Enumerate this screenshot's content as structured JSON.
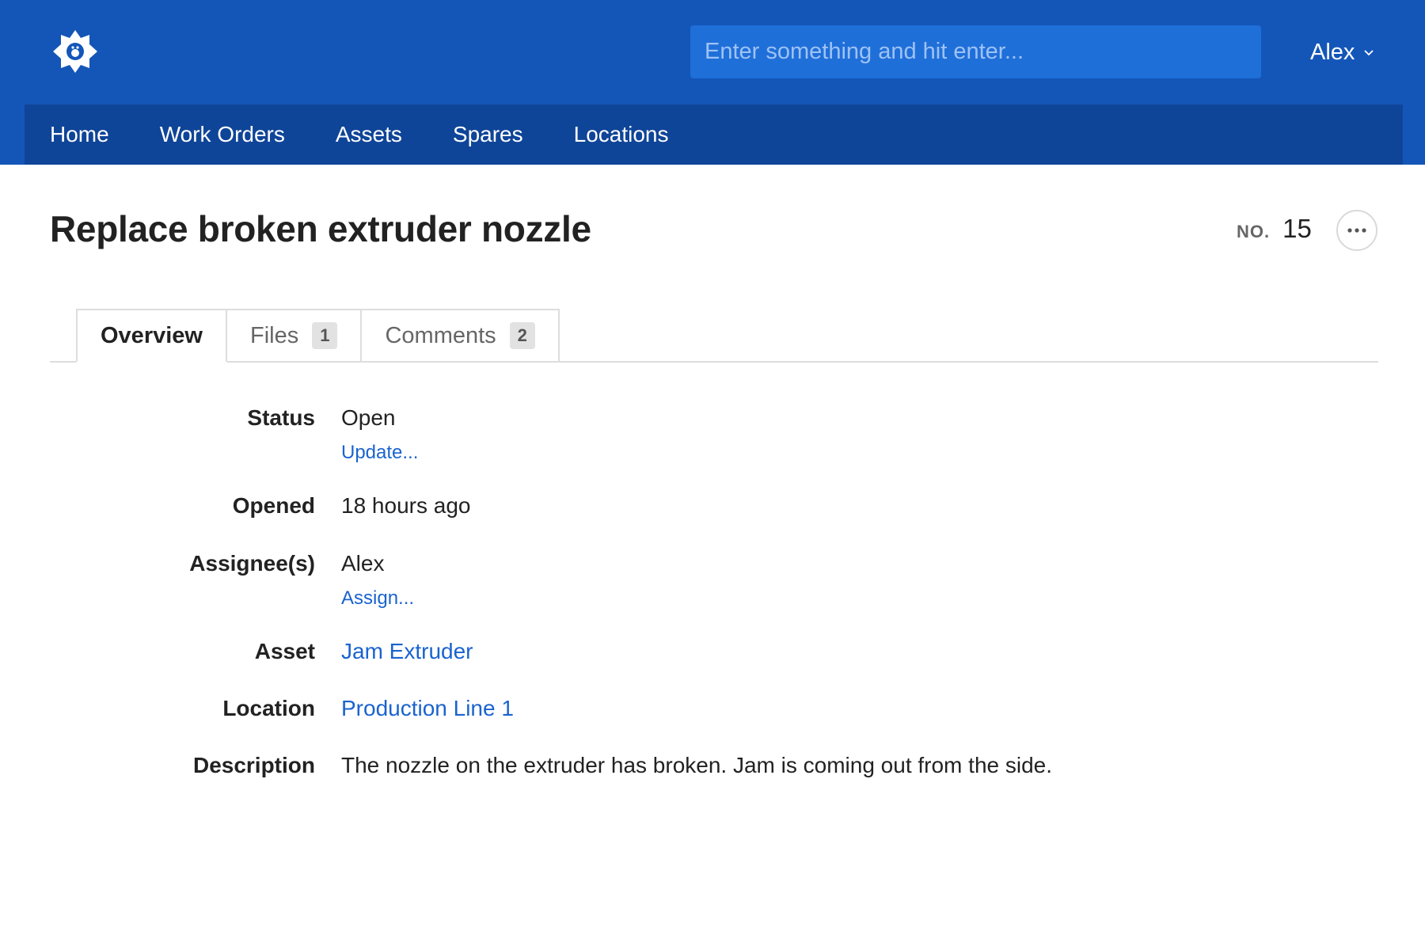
{
  "header": {
    "search_placeholder": "Enter something and hit enter...",
    "user_name": "Alex",
    "brand_color": "#1456b8",
    "nav_color": "#0f4598"
  },
  "nav": {
    "items": [
      {
        "label": "Home"
      },
      {
        "label": "Work Orders"
      },
      {
        "label": "Assets"
      },
      {
        "label": "Spares"
      },
      {
        "label": "Locations"
      }
    ]
  },
  "work_order": {
    "title": "Replace broken extruder nozzle",
    "number_prefix": "NO.",
    "number": "15"
  },
  "tabs": [
    {
      "label": "Overview",
      "active": true
    },
    {
      "label": "Files",
      "count": "1"
    },
    {
      "label": "Comments",
      "count": "2"
    }
  ],
  "details": {
    "status": {
      "label": "Status",
      "value": "Open",
      "action": "Update..."
    },
    "opened": {
      "label": "Opened",
      "value": "18 hours ago"
    },
    "assignees": {
      "label": "Assignee(s)",
      "value": "Alex",
      "action": "Assign..."
    },
    "asset": {
      "label": "Asset",
      "value": "Jam Extruder"
    },
    "location": {
      "label": "Location",
      "value": "Production Line 1"
    },
    "description": {
      "label": "Description",
      "value": "The nozzle on the extruder has broken. Jam is coming out from the side."
    }
  },
  "icons": {
    "logo": "gear-logo-icon",
    "user_menu_chevron": "chevron-down-icon",
    "more": "more-horizontal-icon"
  }
}
